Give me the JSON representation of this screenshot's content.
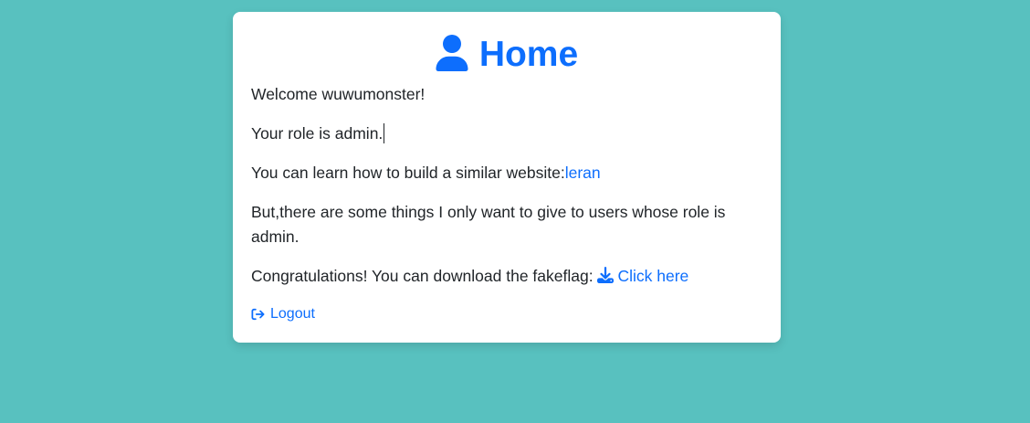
{
  "page": {
    "title": "Home",
    "icon": "user-icon",
    "accent_color": "#0d6efd",
    "background_color": "#58c1bf"
  },
  "content": {
    "welcome": "Welcome wuwumonster!",
    "role": "Your role is admin.",
    "learn_prefix": "You can learn how to build a similar website:",
    "learn_link": "leran",
    "admin_note": "But,there are some things I only want to give to users whose role is admin.",
    "download_prefix": "Congratulations! You can download the fakeflag: ",
    "download_link": "Click here",
    "download_icon": "download-icon"
  },
  "actions": {
    "logout_label": "Logout",
    "logout_icon": "sign-out-icon"
  }
}
